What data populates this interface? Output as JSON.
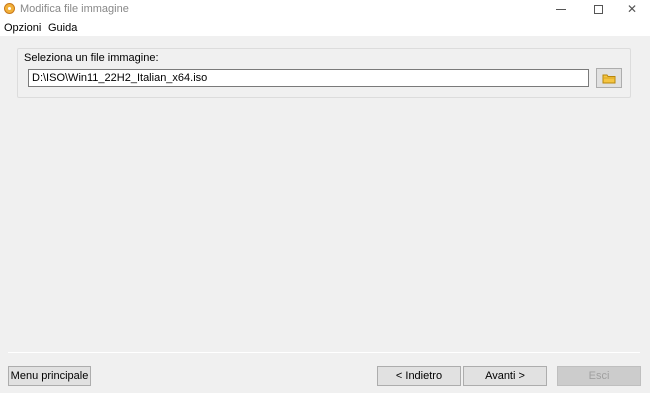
{
  "window": {
    "title": "Modifica file immagine",
    "icon": "app-disc-icon",
    "controls": {
      "minimize": "minimize-icon",
      "maximize": "maximize-icon",
      "close": "close-icon"
    }
  },
  "menu": {
    "items": [
      {
        "label": "Opzioni"
      },
      {
        "label": "Guida"
      }
    ]
  },
  "file_group": {
    "label": "Seleziona un file immagine:",
    "path_value": "D:\\ISO\\Win11_22H2_Italian_x64.iso",
    "browse_icon": "folder-icon"
  },
  "footer": {
    "main_menu_label": "Menu principale",
    "back_label": "< Indietro",
    "next_label": "Avanti >",
    "exit_label": "Esci",
    "exit_enabled": false
  },
  "colors": {
    "background": "#f0f0f0",
    "button_face": "#e1e1e1",
    "folder_icon": "#f5c542"
  }
}
